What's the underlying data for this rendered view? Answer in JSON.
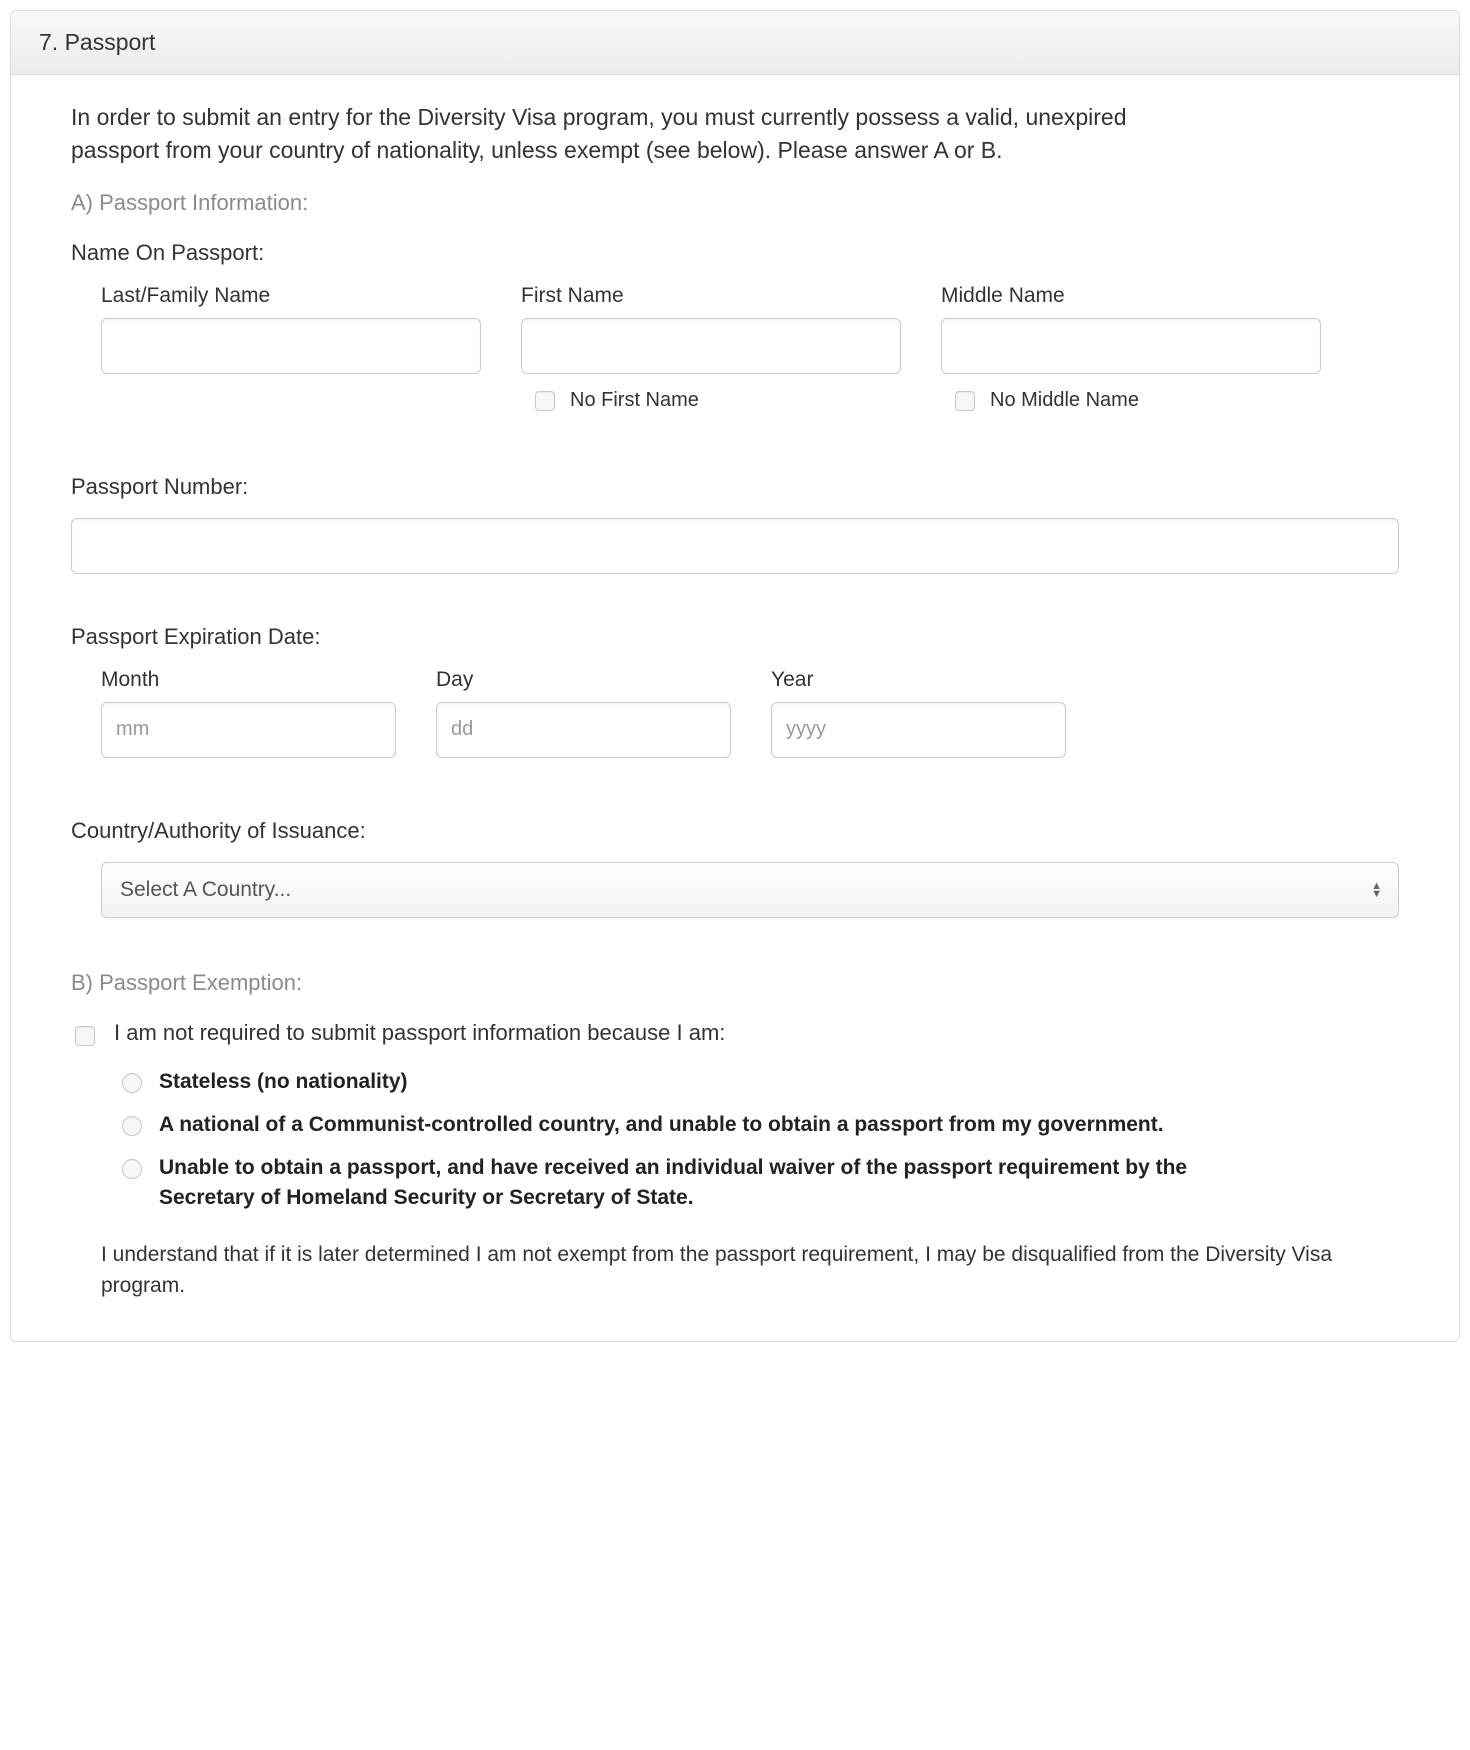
{
  "header": {
    "title": "7. Passport"
  },
  "intro_text": "In order to submit an entry for the Diversity Visa program, you must currently possess a valid, unexpired passport from your country of nationality, unless exempt (see below). Please answer A or B.",
  "section_a": {
    "heading": "A) Passport Information:",
    "name_on_passport_label": "Name On Passport:",
    "last_name": {
      "label": "Last/Family Name",
      "value": ""
    },
    "first_name": {
      "label": "First Name",
      "value": "",
      "no_label": "No First Name"
    },
    "middle_name": {
      "label": "Middle Name",
      "value": "",
      "no_label": "No Middle Name"
    },
    "passport_number": {
      "label": "Passport Number:",
      "value": ""
    },
    "expiration": {
      "label": "Passport Expiration Date:",
      "month_label": "Month",
      "day_label": "Day",
      "year_label": "Year",
      "month_placeholder": "mm",
      "day_placeholder": "dd",
      "year_placeholder": "yyyy"
    },
    "issuance": {
      "label": "Country/Authority of Issuance:",
      "selected": "Select A Country..."
    }
  },
  "section_b": {
    "heading": "B) Passport Exemption:",
    "checkbox_label": "I am not required to submit passport information because I am:",
    "options": [
      "Stateless (no nationality)",
      "A national of a Communist-controlled country, and unable to obtain a passport from my government.",
      "Unable to obtain a passport, and have received an individual waiver of the passport requirement by the Secretary of Homeland Security or Secretary of State."
    ],
    "disclaimer": "I understand that if it is later determined I am not exempt from the passport requirement, I may be disqualified from the Diversity Visa program."
  }
}
